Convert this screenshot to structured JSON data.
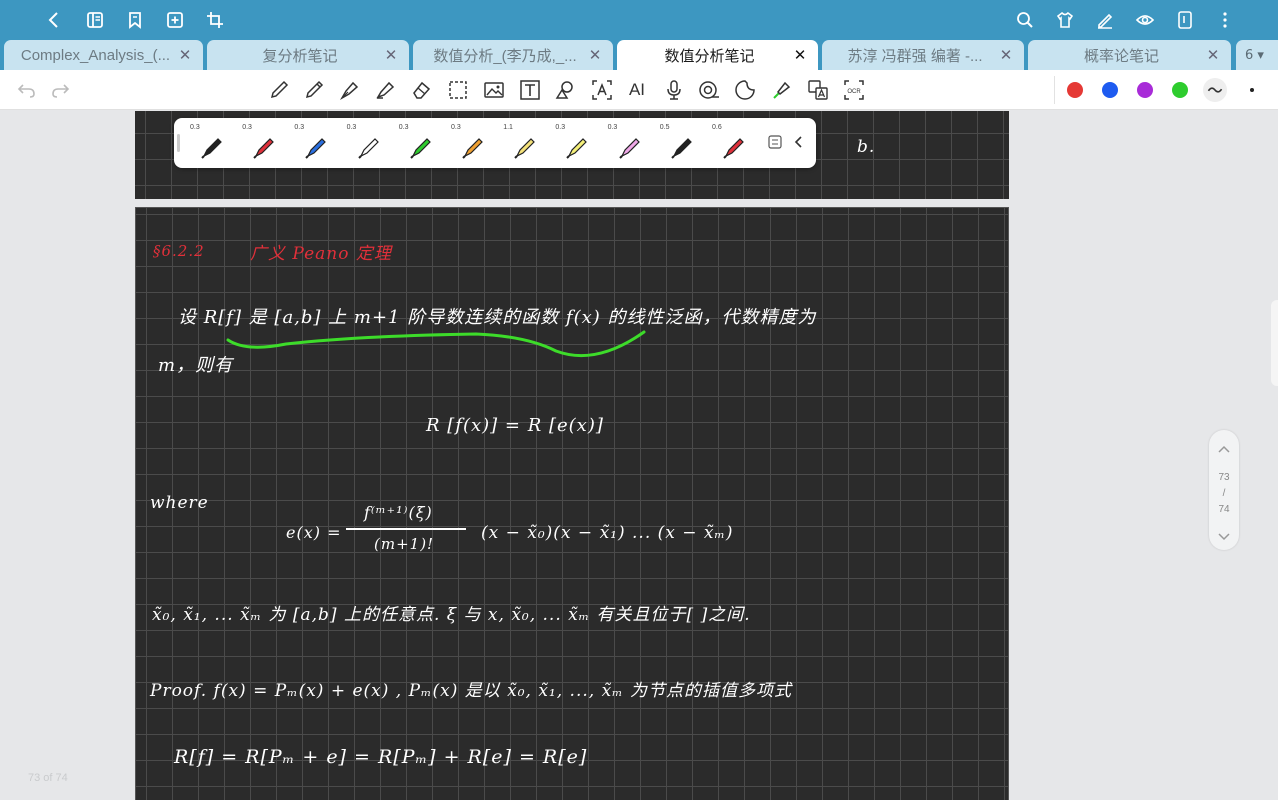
{
  "topbar": {
    "left_icons": [
      "back-chevron-icon",
      "outline-icon",
      "bookmark-icon",
      "add-page-icon",
      "crop-icon"
    ],
    "right_icons": [
      "search-icon",
      "shirt-icon",
      "pen-edit-icon",
      "eye-icon",
      "tablet-icon",
      "more-vertical-icon"
    ]
  },
  "tabs": [
    {
      "label": "Complex_Analysis_(...",
      "active": false
    },
    {
      "label": "复分析笔记",
      "active": false
    },
    {
      "label": "数值分析_(李乃成,_...",
      "active": false
    },
    {
      "label": "数值分析笔记",
      "active": true
    },
    {
      "label": "苏淳 冯群强 编著 -...",
      "active": false
    },
    {
      "label": "概率论笔记",
      "active": false
    }
  ],
  "tab_count": "6 ▾",
  "toolbar": {
    "tools": [
      "undo-icon",
      "redo-icon",
      "pen-icon",
      "pencil-icon",
      "fountain-pen-icon",
      "highlighter-icon",
      "eraser-icon",
      "lasso-select-icon",
      "image-icon",
      "text-box-icon",
      "shape-icon",
      "text-recognize-icon",
      "ai-icon",
      "microphone-icon",
      "tape-icon",
      "sticker-icon",
      "laser-pointer-icon",
      "translate-icon",
      "ocr-icon"
    ],
    "ai_label": "AI",
    "ocr_label": "OCR",
    "colors": [
      "#e53935",
      "#1e5bf0",
      "#a82bd8",
      "#2ecc2e"
    ]
  },
  "pen_palette": [
    {
      "size": "0.3",
      "color": "#222222"
    },
    {
      "size": "0.3",
      "color": "#e0303a"
    },
    {
      "size": "0.3",
      "color": "#2a6fe0"
    },
    {
      "size": "0.3",
      "color": "#ffffff"
    },
    {
      "size": "0.3",
      "color": "#2ecc2e"
    },
    {
      "size": "0.3",
      "color": "#f0a030"
    },
    {
      "size": "1.1",
      "color": "#f5e27a"
    },
    {
      "size": "0.3",
      "color": "#f5f07a"
    },
    {
      "size": "0.3",
      "color": "#f0a8e8"
    },
    {
      "size": "0.5",
      "color": "#222222"
    },
    {
      "size": "0.6",
      "color": "#e0303a"
    }
  ],
  "notes": {
    "prev_page_mark": "b.",
    "heading_section": "§6.2.2",
    "heading_title": "广义 Peano 定理",
    "line1": "设 R[f] 是 [a,b] 上 m+1 阶导数连续的函数 f(x) 的线性泛函，代数精度为",
    "line1b": "m，则有",
    "eq1": "R [f(x)] = R [e(x)]",
    "where": "where",
    "eq2_num": "f⁽ᵐ⁺¹⁾(ξ)",
    "eq2_lhs": "e(x) =",
    "eq2_den": "(m+1)!",
    "eq2_rhs": "(x − x̃₀)(x − x̃₁) ... (x − x̃ₘ)",
    "line3": "x̃₀, x̃₁, ... x̃ₘ 为 [a,b] 上的任意点.   ξ 与 x, x̃₀, ... x̃ₘ 有关且位于[ ]之间.",
    "proof": "Proof.  f(x) = Pₘ(x) + e(x) ,        Pₘ(x) 是以 x̃₀, x̃₁, ..., x̃ₘ 为节点的插值多项式",
    "eq3": "R[f] = R[Pₘ + e] = R[Pₘ] + R[e] = R[e]"
  },
  "scroll": {
    "current": "73",
    "sep": "/",
    "total": "74"
  },
  "page_indicator": "73 of 74"
}
